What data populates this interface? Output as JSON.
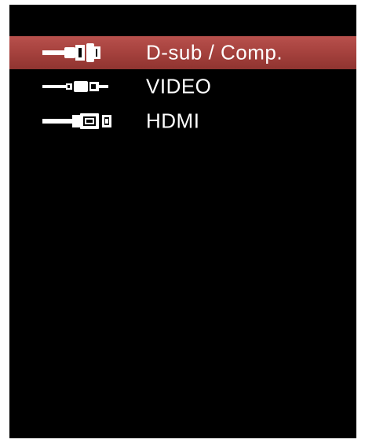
{
  "source_menu": {
    "selected_index": 0,
    "items": [
      {
        "label": "D-sub / Comp.",
        "icon": "vga-connector-icon"
      },
      {
        "label": "VIDEO",
        "icon": "rca-video-connector-icon"
      },
      {
        "label": "HDMI",
        "icon": "hdmi-connector-icon"
      }
    ]
  },
  "colors": {
    "screen_background": "#000000",
    "selection_highlight": "#a3403c",
    "text": "#ffffff",
    "frame": "#ffffff"
  }
}
